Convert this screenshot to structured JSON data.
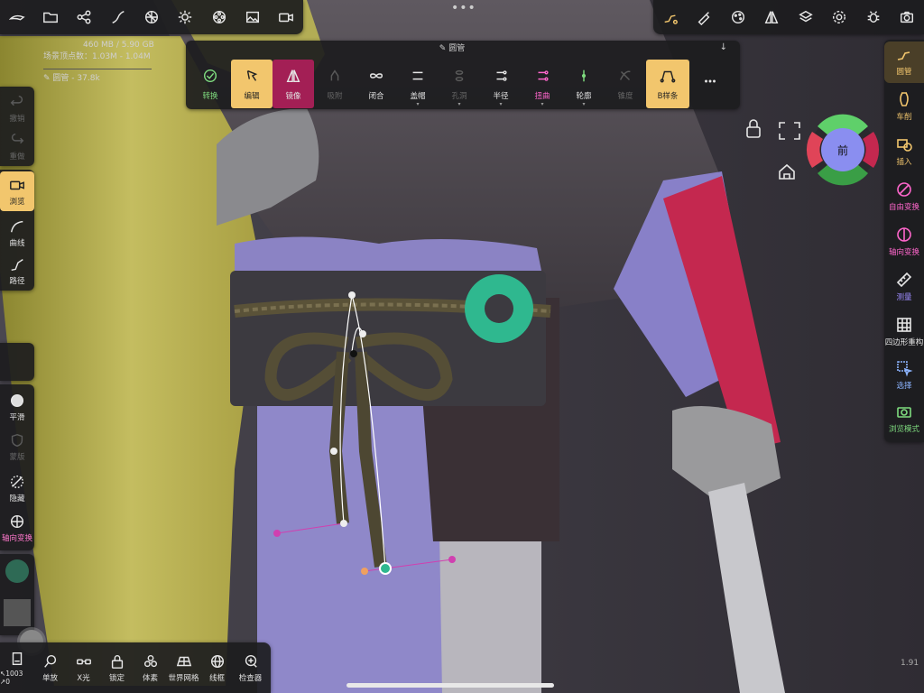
{
  "colors": {
    "accent_yellow": "#f2c66d",
    "accent_magenta": "#a31f55",
    "panel_bg": "#1c1c1e",
    "green": "#7fdc7f",
    "pink": "#ff66cc"
  },
  "top_left_icons": [
    "sculpt-pen-icon",
    "folder-icon",
    "share-nodes-icon",
    "stroke-icon",
    "texture-icon",
    "sun-icon",
    "film-reel-icon",
    "image-icon",
    "camera-icon"
  ],
  "top_right_icons": [
    "curve-tool-icon",
    "brush-icon",
    "palette-icon",
    "symmetry-icon",
    "layers-icon",
    "settings-gear-icon",
    "bug-icon",
    "camera-icon"
  ],
  "info": {
    "memory": "460 MB / 5.90 GB",
    "scene_prefix": "场景顶点数：",
    "scene_vertices": "1.03M",
    "scene_extra": "1.04M",
    "selected_object": "圆管",
    "selected_vertices": "37.8k"
  },
  "tube_bar": {
    "title": "圆管",
    "collapse_glyph": "↓",
    "items": [
      {
        "key": "convert",
        "label": "转换",
        "icon": "check-circle-icon",
        "state": "green"
      },
      {
        "key": "edit",
        "label": "编辑",
        "icon": "edit-bone-icon",
        "state": "sel-y"
      },
      {
        "key": "mirror",
        "label": "镜像",
        "icon": "mirror-icon",
        "state": "sel-m"
      },
      {
        "key": "snap",
        "label": "吸附",
        "icon": "snap-icon",
        "state": "dis"
      },
      {
        "key": "close",
        "label": "闭合",
        "icon": "infinity-icon",
        "state": ""
      },
      {
        "key": "cap",
        "label": "盖帽",
        "icon": "cap-icon",
        "state": ""
      },
      {
        "key": "hole",
        "label": "孔洞",
        "icon": "hole-icon",
        "state": "dis"
      },
      {
        "key": "radius",
        "label": "半径",
        "icon": "radius-icon",
        "state": ""
      },
      {
        "key": "twist",
        "label": "扭曲",
        "icon": "twist-icon",
        "state": "mag"
      },
      {
        "key": "profile",
        "label": "轮廓",
        "icon": "profile-icon",
        "state": ""
      },
      {
        "key": "taper",
        "label": "锥度",
        "icon": "taper-icon",
        "state": "dis"
      },
      {
        "key": "bspline",
        "label": "B样条",
        "icon": "bspline-icon",
        "state": "sel-y"
      },
      {
        "key": "more",
        "label": "",
        "icon": "more-icon",
        "state": ""
      }
    ]
  },
  "left_tools": [
    {
      "key": "undo",
      "label": "撤销",
      "state": "dis"
    },
    {
      "key": "redo",
      "label": "重做",
      "state": "dis"
    },
    {
      "key": "view",
      "label": "浏览",
      "state": "sel"
    },
    {
      "key": "curve",
      "label": "曲线",
      "state": ""
    },
    {
      "key": "path",
      "label": "路径",
      "state": ""
    },
    {
      "key": "smooth",
      "label": "平滑",
      "state": ""
    },
    {
      "key": "mask",
      "label": "蒙版",
      "state": "dis"
    },
    {
      "key": "hide",
      "label": "隐藏",
      "state": ""
    },
    {
      "key": "axial",
      "label": "轴向变换",
      "state": "pink"
    }
  ],
  "right_tools": [
    {
      "key": "tube",
      "label": "圆管",
      "color": "#f2c66d",
      "active": true
    },
    {
      "key": "lathe",
      "label": "车削",
      "color": "#f2c66d"
    },
    {
      "key": "insert",
      "label": "插入",
      "color": "#f2c66d"
    },
    {
      "key": "freeform",
      "label": "自由变换",
      "color": "#ff66cc"
    },
    {
      "key": "axial",
      "label": "轴向变换",
      "color": "#ff66cc"
    },
    {
      "key": "measure",
      "label": "测量",
      "color": "#9e8cff"
    },
    {
      "key": "retopo",
      "label": "四边形重构",
      "color": "#e6e6e6"
    },
    {
      "key": "select",
      "label": "选择",
      "color": "#8cb4ff"
    },
    {
      "key": "view_mode",
      "label": "浏览模式",
      "color": "#7fdc7f"
    }
  ],
  "bottom_tools": [
    {
      "key": "counter",
      "label": "↖1003 ↗0"
    },
    {
      "key": "zoom",
      "label": "单放"
    },
    {
      "key": "xray",
      "label": "X光"
    },
    {
      "key": "lock",
      "label": "锁定"
    },
    {
      "key": "voxel",
      "label": "体素"
    },
    {
      "key": "grid",
      "label": "世界网格"
    },
    {
      "key": "wire",
      "label": "线框"
    },
    {
      "key": "inspector",
      "label": "检查器"
    }
  ],
  "gizmo_label": "前",
  "version": "1.91"
}
